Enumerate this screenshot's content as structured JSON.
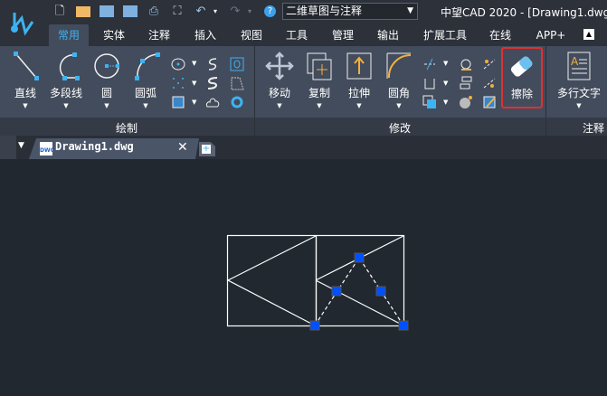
{
  "app": {
    "title": "中望CAD 2020 - [Drawing1.dwg]",
    "workspace": "二维草图与注释"
  },
  "ribbon_tabs": [
    {
      "label": "常用",
      "active": true
    },
    {
      "label": "实体"
    },
    {
      "label": "注释"
    },
    {
      "label": "插入"
    },
    {
      "label": "视图"
    },
    {
      "label": "工具"
    },
    {
      "label": "管理"
    },
    {
      "label": "输出"
    },
    {
      "label": "扩展工具"
    },
    {
      "label": "在线"
    },
    {
      "label": "APP+"
    }
  ],
  "panels": {
    "draw": {
      "label": "绘制",
      "tools": [
        "直线",
        "多段线",
        "圆",
        "圆弧"
      ]
    },
    "modify": {
      "label": "修改",
      "tools": [
        "移动",
        "复制",
        "拉伸",
        "圆角",
        "擦除"
      ]
    },
    "annotate": {
      "label": "注释",
      "tools": [
        "多行文字"
      ]
    }
  },
  "document": {
    "tab": "Drawing1.dwg"
  },
  "colors": {
    "accent": "#3fb2f0",
    "highlight": "#e03030",
    "grip": "#0050ff"
  }
}
